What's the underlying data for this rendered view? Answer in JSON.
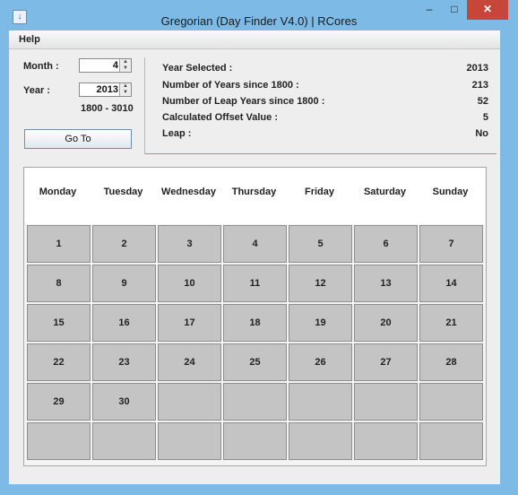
{
  "window": {
    "title": "Gregorian (Day Finder V4.0) | RCores",
    "min_glyph": "–",
    "max_glyph": "□",
    "close_glyph": "✕",
    "app_icon_glyph": "↓"
  },
  "menu": {
    "help": "Help"
  },
  "form": {
    "month_label": "Month :",
    "month_value": "4",
    "year_label": "Year :",
    "year_value": "2013",
    "range_text": "1800 - 3010",
    "goto_label": "Go To",
    "spinner_up_glyph": "▲",
    "spinner_down_glyph": "▼"
  },
  "info": {
    "year_selected_label": "Year Selected :",
    "year_selected_value": "2013",
    "years_since_label": "Number of Years since 1800 :",
    "years_since_value": "213",
    "leap_years_label": "Number of Leap Years since 1800 :",
    "leap_years_value": "52",
    "offset_label": "Calculated Offset Value :",
    "offset_value": "5",
    "leap_label": "Leap :",
    "leap_value": "No"
  },
  "calendar": {
    "weekdays": [
      "Monday",
      "Tuesday",
      "Wednesday",
      "Thursday",
      "Friday",
      "Saturday",
      "Sunday"
    ],
    "cells": [
      [
        "1",
        "2",
        "3",
        "4",
        "5",
        "6",
        "7"
      ],
      [
        "8",
        "9",
        "10",
        "11",
        "12",
        "13",
        "14"
      ],
      [
        "15",
        "16",
        "17",
        "18",
        "19",
        "20",
        "21"
      ],
      [
        "22",
        "23",
        "24",
        "25",
        "26",
        "27",
        "28"
      ],
      [
        "29",
        "30",
        "",
        "",
        "",
        "",
        ""
      ],
      [
        "",
        "",
        "",
        "",
        "",
        "",
        ""
      ]
    ]
  },
  "colors": {
    "frame": "#7dbbe6",
    "close_button": "#c7463a",
    "cell_fill": "#c4c4c4",
    "panel_bg": "#eeeeee"
  }
}
